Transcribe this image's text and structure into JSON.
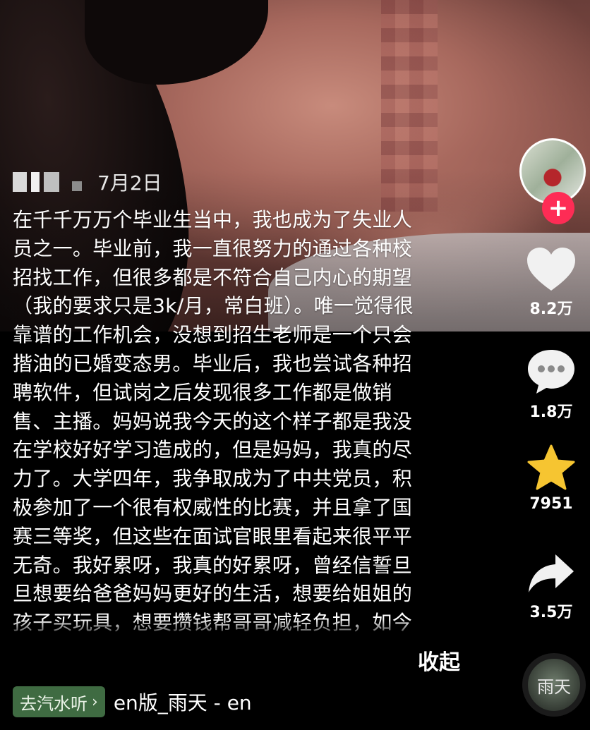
{
  "post": {
    "date": "7月2日",
    "caption_lines": [
      "在千千万万个毕业生当中，我也成为了失业人",
      "员之一。毕业前，我一直很努力的通过各种校",
      "招找工作，但很多都是不符合自己内心的期望",
      "（我的要求只是3k/月，常白班）。唯一觉得很",
      "靠谱的工作机会，没想到招生老师是一个只会",
      "揩油的已婚变态男。毕业后，我也尝试各种招",
      "聘软件，但试岗之后发现很多工作都是做销",
      "售、主播。妈妈说我今天的这个样子都是我没",
      "在学校好好学习造成的，但是妈妈，我真的尽",
      "力了。大学四年，我争取成为了中共党员，积",
      "极参加了一个很有权威性的比赛，并且拿了国",
      "赛三等奖，但这些在面试官眼里看起来很平平",
      "无奇。我好累呀，我真的好累呀，曾经信誓旦",
      "旦想要给爸爸妈妈更好的生活，想要给姐姐的",
      "孩子买玩具，想要攒钱帮哥哥减轻负担，如今"
    ],
    "collapse_label": "收起"
  },
  "music": {
    "tag_label": "去汽水听",
    "tag_chevron": "›",
    "track_name": "en版_雨天 - en",
    "disc_text": "雨天"
  },
  "actions": {
    "likes": "8.2万",
    "comments": "1.8万",
    "favorites": "7951",
    "shares": "3.5万",
    "follow_symbol": "+"
  },
  "colors": {
    "follow_red": "#fe2c55",
    "favorite_yellow": "#f6c531",
    "music_tag_green": "#3f6b42"
  },
  "icons": [
    "heart-icon",
    "comment-icon",
    "star-icon",
    "share-icon",
    "plus-icon",
    "chevron-right-icon"
  ]
}
